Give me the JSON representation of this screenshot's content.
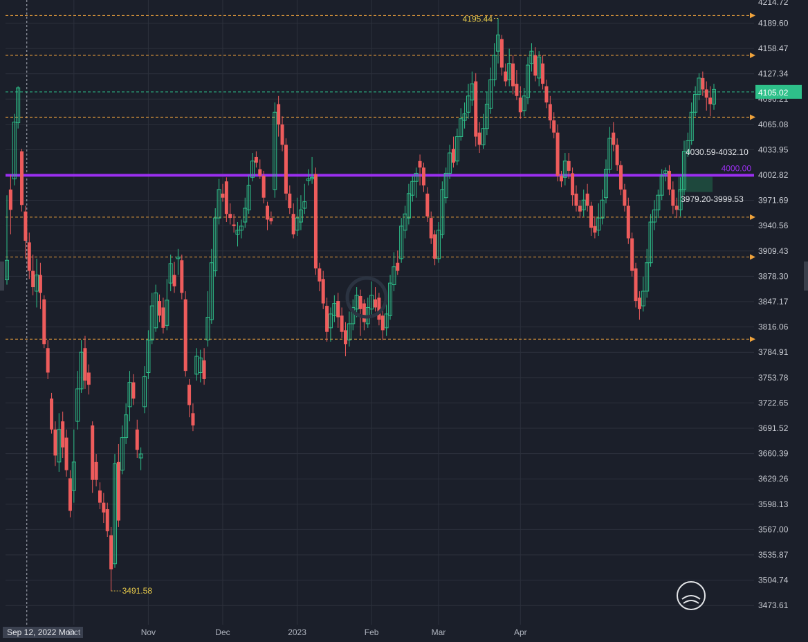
{
  "chart_data": {
    "type": "candlestick",
    "y_ticks": [
      4189.6,
      4158.47,
      4127.34,
      4096.21,
      4065.08,
      4033.95,
      4002.82,
      3971.69,
      3940.56,
      3909.43,
      3878.3,
      3847.17,
      3816.06,
      3784.91,
      3753.78,
      3722.65,
      3691.52,
      3660.39,
      3629.26,
      3598.13,
      3567.0,
      3535.87,
      3504.74,
      3473.61
    ],
    "y_top_label": "4214.72",
    "ylim": [
      3450.0,
      4218.0
    ],
    "x_labels": [
      "Sep 12, 2022 Mon.",
      "Oct",
      "Nov",
      "Dec",
      "2023",
      "Feb",
      "Mar",
      "Apr"
    ],
    "x_label_indices": [
      2,
      18,
      38,
      58,
      78,
      98,
      116,
      138
    ],
    "last_price": "4105.02",
    "horizontal_levels": [
      4199.0,
      4150.0,
      4074.0,
      3951.0,
      3902.0,
      3801.0
    ],
    "key_level": {
      "value": 4002.5,
      "label": "4000.00",
      "color": "#9b2ff0"
    },
    "annotations": {
      "high": "4195.44",
      "low": "3491.58",
      "upper_zone": "4030.59-4032.10",
      "lower_zone": "3979.20-3999.53"
    },
    "colors": {
      "up": "#2ec08a",
      "down": "#ee5c5c",
      "level": "#f0a33c",
      "grid": "#2c313c",
      "last_price_bg": "#2ec08a"
    },
    "candles": [
      [
        3874,
        3898,
        3978,
        3868
      ],
      [
        3985,
        3960,
        4003,
        3930
      ],
      [
        3998,
        4068,
        4078,
        3990
      ],
      [
        4067,
        4110,
        4112,
        4060
      ],
      [
        4032,
        3966,
        4035,
        3958
      ],
      [
        3958,
        3922,
        3965,
        3900
      ],
      [
        3920,
        3885,
        3932,
        3875
      ],
      [
        3885,
        3865,
        3905,
        3855
      ],
      [
        3860,
        3880,
        3900,
        3840
      ],
      [
        3880,
        3858,
        3895,
        3838
      ],
      [
        3850,
        3795,
        3855,
        3790
      ],
      [
        3790,
        3760,
        3800,
        3752
      ],
      [
        3728,
        3690,
        3735,
        3685
      ],
      [
        3690,
        3658,
        3700,
        3645
      ],
      [
        3650,
        3690,
        3710,
        3638
      ],
      [
        3700,
        3668,
        3712,
        3655
      ],
      [
        3680,
        3640,
        3690,
        3632
      ],
      [
        3630,
        3590,
        3640,
        3582
      ],
      [
        3615,
        3650,
        3690,
        3600
      ],
      [
        3700,
        3740,
        3762,
        3690
      ],
      [
        3740,
        3785,
        3800,
        3735
      ],
      [
        3790,
        3750,
        3805,
        3740
      ],
      [
        3760,
        3745,
        3770,
        3733
      ],
      [
        3695,
        3628,
        3700,
        3612
      ],
      [
        3650,
        3628,
        3660,
        3620
      ],
      [
        3615,
        3600,
        3625,
        3592
      ],
      [
        3600,
        3588,
        3612,
        3575
      ],
      [
        3592,
        3565,
        3600,
        3558
      ],
      [
        3560,
        3518,
        3570,
        3491.58
      ],
      [
        3525,
        3648,
        3660,
        3520
      ],
      [
        3650,
        3578,
        3672,
        3570
      ],
      [
        3640,
        3680,
        3695,
        3635
      ],
      [
        3680,
        3708,
        3722,
        3672
      ],
      [
        3718,
        3748,
        3762,
        3700
      ],
      [
        3748,
        3728,
        3758,
        3720
      ],
      [
        3690,
        3665,
        3702,
        3655
      ],
      [
        3655,
        3660,
        3668,
        3640
      ],
      [
        3718,
        3755,
        3768,
        3710
      ],
      [
        3760,
        3800,
        3812,
        3752
      ],
      [
        3800,
        3842,
        3858,
        3795
      ],
      [
        3815,
        3858,
        3868,
        3810
      ],
      [
        3848,
        3830,
        3856,
        3822
      ],
      [
        3840,
        3815,
        3852,
        3808
      ],
      [
        3818,
        3849,
        3875,
        3812
      ],
      [
        3870,
        3894,
        3905,
        3860
      ],
      [
        3880,
        3866,
        3896,
        3858
      ],
      [
        3900,
        3902,
        3912,
        3880
      ],
      [
        3898,
        3858,
        3905,
        3850
      ],
      [
        3850,
        3762,
        3860,
        3755
      ],
      [
        3745,
        3720,
        3752,
        3705
      ],
      [
        3710,
        3695,
        3722,
        3688
      ],
      [
        3758,
        3780,
        3790,
        3750
      ],
      [
        3760,
        3778,
        3788,
        3748
      ],
      [
        3775,
        3752,
        3790,
        3745
      ],
      [
        3800,
        3828,
        3860,
        3792
      ],
      [
        3825,
        3895,
        3912,
        3820
      ],
      [
        3885,
        3950,
        3962,
        3878
      ],
      [
        3950,
        3985,
        3998,
        3942
      ],
      [
        3980,
        3975,
        3992,
        3970
      ],
      [
        3995,
        3955,
        4000,
        3945
      ],
      [
        3955,
        3950,
        3968,
        3942
      ],
      [
        3942,
        3940,
        3955,
        3932
      ],
      [
        3930,
        3935,
        3945,
        3915
      ],
      [
        3935,
        3940,
        3948,
        3925
      ],
      [
        3945,
        3962,
        3975,
        3938
      ],
      [
        3960,
        3990,
        4003,
        3955
      ],
      [
        4000,
        4020,
        4030,
        3995
      ],
      [
        4025,
        4018,
        4032,
        4012
      ],
      [
        4010,
        4002,
        4022,
        3998
      ],
      [
        4002,
        3975,
        4008,
        3968
      ],
      [
        3965,
        3948,
        3970,
        3935
      ],
      [
        3950,
        3946,
        3958,
        3942
      ],
      [
        3985,
        4080,
        4092,
        3975
      ],
      [
        4090,
        4065,
        4100,
        4050
      ],
      [
        4065,
        4040,
        4075,
        4032
      ],
      [
        4040,
        3980,
        4048,
        3972
      ],
      [
        3980,
        3962,
        3990,
        3955
      ],
      [
        3955,
        3930,
        3968,
        3925
      ],
      [
        3935,
        3950,
        3975,
        3928
      ],
      [
        3945,
        3960,
        3978,
        3935
      ],
      [
        3962,
        3970,
        3992,
        3955
      ],
      [
        3996,
        3998,
        4010,
        3990
      ],
      [
        3998,
        4000,
        4025,
        3992
      ],
      [
        4004,
        3888,
        4012,
        3880
      ],
      [
        3888,
        3872,
        3895,
        3860
      ],
      [
        3875,
        3845,
        3885,
        3838
      ],
      [
        3842,
        3810,
        3852,
        3798
      ],
      [
        3815,
        3832,
        3840,
        3798
      ],
      [
        3830,
        3845,
        3855,
        3822
      ],
      [
        3848,
        3828,
        3858,
        3815
      ],
      [
        3830,
        3810,
        3840,
        3802
      ],
      [
        3812,
        3795,
        3822,
        3780
      ],
      [
        3800,
        3820,
        3835,
        3792
      ],
      [
        3820,
        3840,
        3850,
        3812
      ],
      [
        3838,
        3855,
        3865,
        3828
      ],
      [
        3854,
        3838,
        3862,
        3805
      ],
      [
        3845,
        3822,
        3850,
        3812
      ],
      [
        3820,
        3840,
        3852,
        3815
      ],
      [
        3838,
        3855,
        3872,
        3830
      ],
      [
        3850,
        3840,
        3865,
        3835
      ],
      [
        3852,
        3825,
        3858,
        3818
      ],
      [
        3830,
        3812,
        3840,
        3800
      ],
      [
        3815,
        3832,
        3845,
        3805
      ],
      [
        3830,
        3870,
        3880,
        3825
      ],
      [
        3868,
        3890,
        3908,
        3860
      ],
      [
        3895,
        3885,
        3910,
        3880
      ],
      [
        3900,
        3940,
        3950,
        3895
      ],
      [
        3935,
        3955,
        3965,
        3925
      ],
      [
        3950,
        3980,
        3992,
        3942
      ],
      [
        3978,
        3995,
        4002,
        3970
      ],
      [
        3995,
        4005,
        4012,
        3975
      ],
      [
        4020,
        4012,
        4028,
        3990
      ],
      [
        4012,
        3990,
        4018,
        3982
      ],
      [
        3980,
        3952,
        3988,
        3945
      ],
      [
        3950,
        3925,
        3958,
        3918
      ],
      [
        3930,
        3900,
        3935,
        3892
      ],
      [
        3900,
        3935,
        3945,
        3895
      ],
      [
        3930,
        3985,
        3995,
        3925
      ],
      [
        3975,
        4005,
        4012,
        3968
      ],
      [
        4005,
        4030,
        4040,
        3998
      ],
      [
        4035,
        4018,
        4050,
        4012
      ],
      [
        4020,
        4050,
        4060,
        4015
      ],
      [
        4050,
        4072,
        4085,
        4045
      ],
      [
        4070,
        4078,
        4092,
        4060
      ],
      [
        4080,
        4100,
        4115,
        4072
      ],
      [
        4095,
        4115,
        4130,
        4088
      ],
      [
        4118,
        4050,
        4128,
        4038
      ],
      [
        4055,
        4040,
        4068,
        4030
      ],
      [
        4040,
        4060,
        4078,
        4035
      ],
      [
        4060,
        4090,
        4105,
        4052
      ],
      [
        4085,
        4120,
        4135,
        4078
      ],
      [
        4120,
        4150,
        4165,
        4112
      ],
      [
        4155,
        4175,
        4195.44,
        4140
      ],
      [
        4170,
        4135,
        4175,
        4125
      ],
      [
        4130,
        4118,
        4140,
        4112
      ],
      [
        4120,
        4140,
        4158,
        4112
      ],
      [
        4140,
        4112,
        4150,
        4102
      ],
      [
        4115,
        4100,
        4132,
        4095
      ],
      [
        4098,
        4080,
        4112,
        4072
      ],
      [
        4082,
        4100,
        4110,
        4075
      ],
      [
        4098,
        4138,
        4148,
        4090
      ],
      [
        4140,
        4155,
        4165,
        4130
      ],
      [
        4150,
        4125,
        4160,
        4118
      ],
      [
        4122,
        4148,
        4155,
        4112
      ],
      [
        4140,
        4115,
        4150,
        4108
      ],
      [
        4112,
        4092,
        4120,
        4085
      ],
      [
        4090,
        4070,
        4100,
        4060
      ],
      [
        4070,
        4055,
        4080,
        4048
      ],
      [
        4055,
        4002,
        4065,
        3995
      ],
      [
        4002,
        3995,
        4008,
        3988
      ],
      [
        4000,
        4020,
        4030,
        3990
      ],
      [
        4020,
        4008,
        4030,
        3998
      ],
      [
        4005,
        3978,
        4012,
        3965
      ],
      [
        3980,
        3965,
        3990,
        3958
      ],
      [
        3965,
        3958,
        3972,
        3950
      ],
      [
        3960,
        3972,
        3985,
        3952
      ],
      [
        3980,
        3965,
        3992,
        3958
      ],
      [
        3965,
        3938,
        3970,
        3928
      ],
      [
        3940,
        3932,
        3952,
        3925
      ],
      [
        3935,
        3950,
        3968,
        3928
      ],
      [
        3950,
        3972,
        3985,
        3942
      ],
      [
        3975,
        4010,
        4022,
        3968
      ],
      [
        4010,
        4048,
        4062,
        4005
      ],
      [
        4055,
        4040,
        4068,
        4032
      ],
      [
        4040,
        4015,
        4048,
        4008
      ],
      [
        4015,
        3985,
        4020,
        3978
      ],
      [
        3985,
        3965,
        3992,
        3958
      ],
      [
        3965,
        3925,
        3975,
        3918
      ],
      [
        3925,
        3885,
        3932,
        3878
      ],
      [
        3888,
        3848,
        3895,
        3840
      ],
      [
        3852,
        3838,
        3860,
        3825
      ],
      [
        3842,
        3860,
        3878,
        3835
      ],
      [
        3860,
        3895,
        3912,
        3852
      ],
      [
        3895,
        3945,
        3955,
        3890
      ],
      [
        3945,
        3960,
        3972,
        3935
      ],
      [
        3960,
        3978,
        3985,
        3950
      ],
      [
        3978,
        4002,
        4010,
        3972
      ],
      [
        4005,
        4008,
        4012,
        3995
      ],
      [
        4008,
        3985,
        4015,
        3978
      ],
      [
        3985,
        3965,
        3995,
        3955
      ],
      [
        3965,
        3960,
        3975,
        3950
      ],
      [
        3960,
        3985,
        4000,
        3952
      ],
      [
        3985,
        4032,
        4045,
        3978
      ],
      [
        4030,
        4045,
        4055,
        4025
      ],
      [
        4045,
        4080,
        4092,
        4040
      ],
      [
        4080,
        4102,
        4112,
        4075
      ],
      [
        4102,
        4122,
        4128,
        4095
      ],
      [
        4122,
        4108,
        4130,
        4100
      ],
      [
        4108,
        4098,
        4118,
        4082
      ],
      [
        4098,
        4090,
        4112,
        4075
      ],
      [
        4090,
        4108,
        4115,
        4083
      ]
    ]
  }
}
